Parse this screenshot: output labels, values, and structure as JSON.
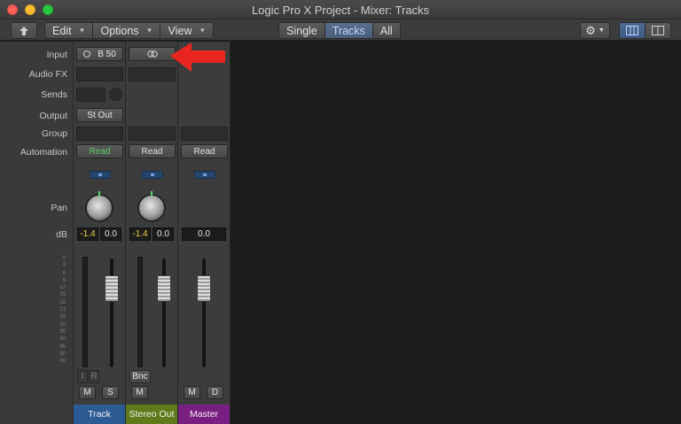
{
  "window": {
    "title": "Logic Pro X Project - Mixer: Tracks"
  },
  "toolbar": {
    "menus": [
      "Edit",
      "Options",
      "View"
    ],
    "view_tabs": [
      "Single",
      "Tracks",
      "All"
    ],
    "active_tab": "Tracks"
  },
  "labels": [
    "Input",
    "Audio FX",
    "Sends",
    "Output",
    "Group",
    "Automation",
    "Pan",
    "dB"
  ],
  "meter_scale": [
    "0",
    "3",
    "6",
    "9",
    "12",
    "15",
    "18",
    "21",
    "24",
    "30",
    "35",
    "40",
    "45",
    "50",
    "60"
  ],
  "strips": [
    {
      "name": "Track",
      "color": "#2c5a93",
      "input": "B 50",
      "output": "St Out",
      "automation": "Read",
      "db_peak": "-1.4",
      "db_volume": "0.0",
      "buttons": [
        "M",
        "S"
      ],
      "small_buttons": [
        "I",
        "R"
      ]
    },
    {
      "name": "Stereo Out",
      "color": "#5e7a1a",
      "automation": "Read",
      "db_peak": "-1.4",
      "db_volume": "0.0",
      "buttons": [
        "M"
      ],
      "extra_button": "Bnc"
    },
    {
      "name": "Master",
      "color": "#7a1f82",
      "automation": "Read",
      "db_volume": "0.0",
      "buttons": [
        "M",
        "D"
      ]
    }
  ],
  "colors": {
    "automation_green": "#5fd36b",
    "peak_yellow": "#f0d23c",
    "annotation_arrow": "#e8261f"
  }
}
